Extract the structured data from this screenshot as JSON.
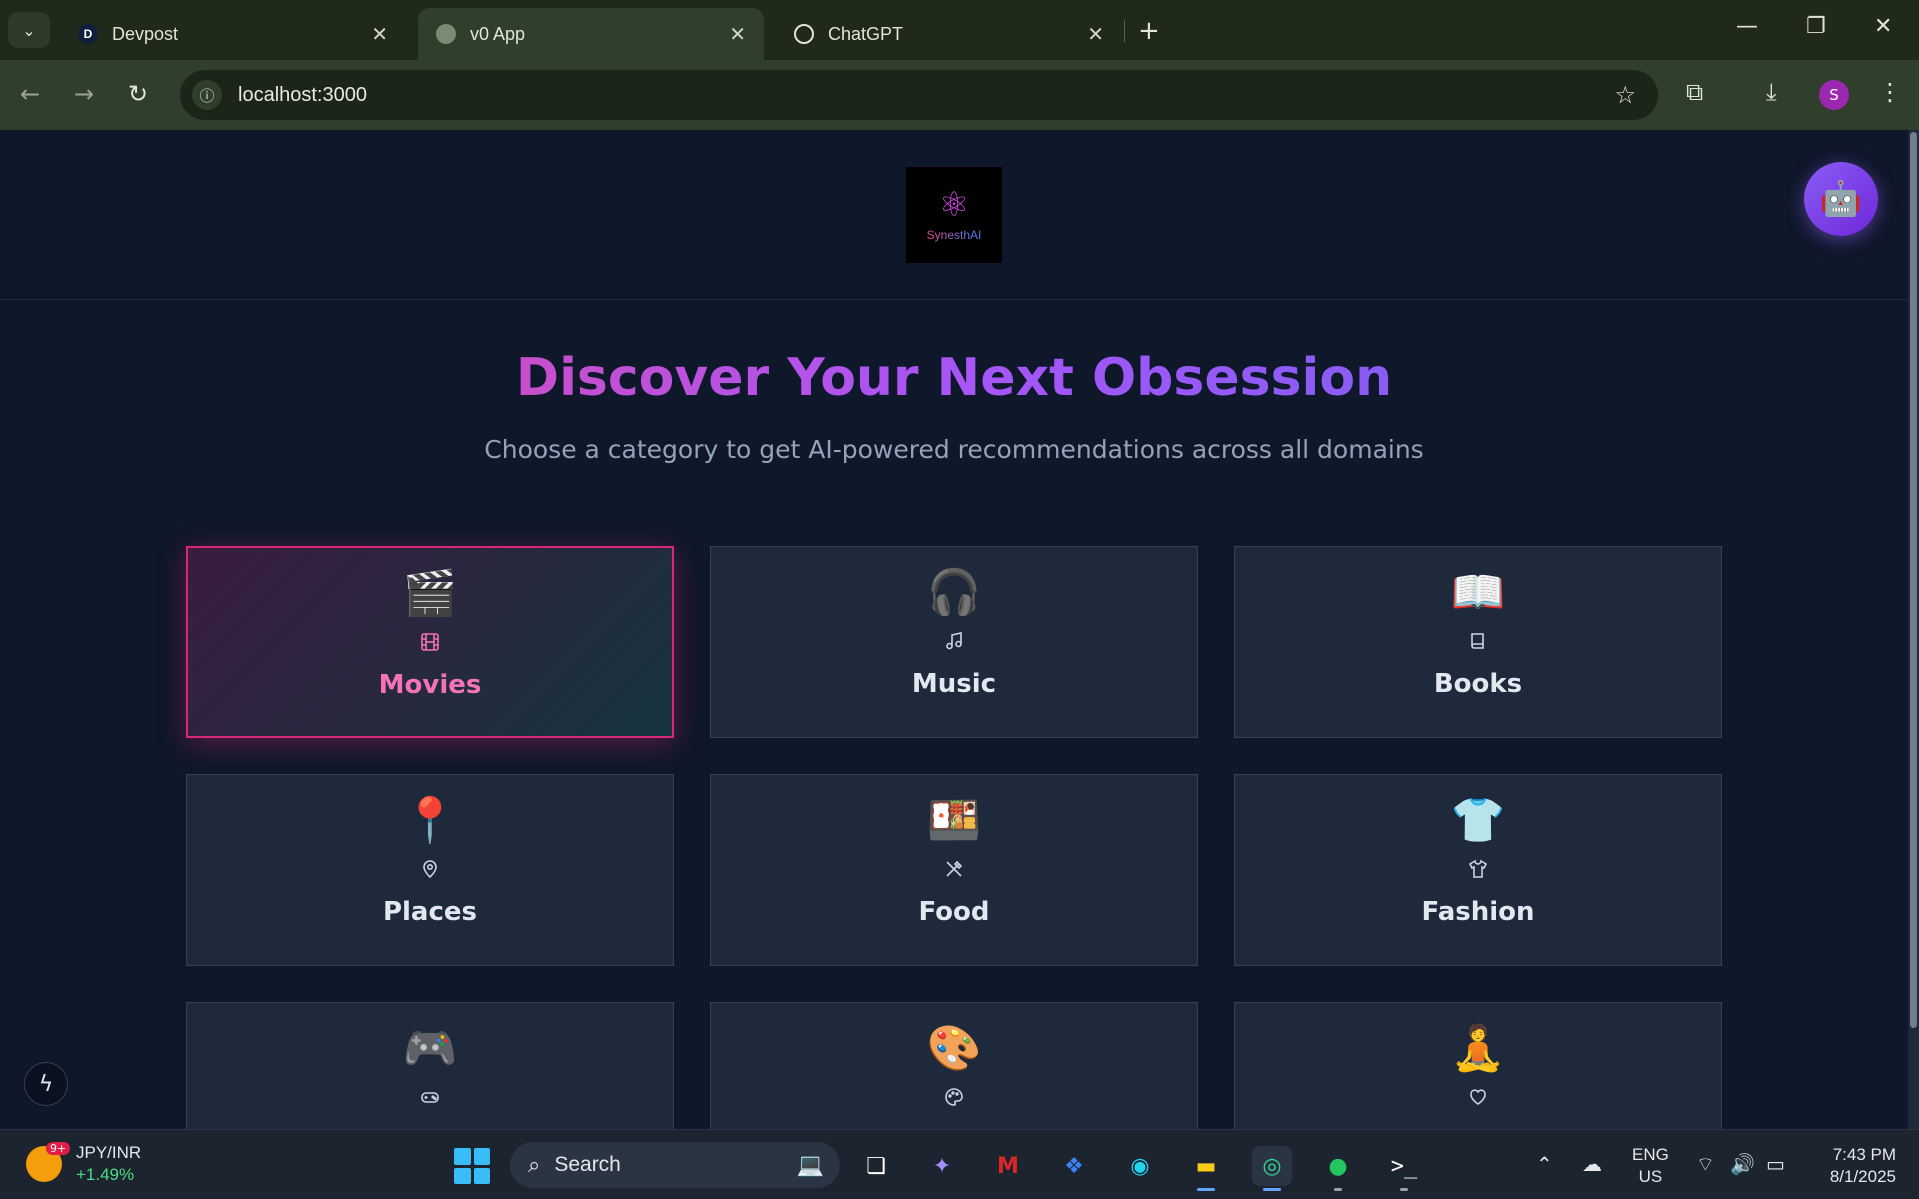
{
  "browser": {
    "tabs": [
      {
        "title": "Devpost",
        "favicon": "D"
      },
      {
        "title": "v0 App",
        "favicon": "globe-icon"
      },
      {
        "title": "ChatGPT",
        "favicon": "openai-icon"
      }
    ],
    "url": "localhost:3000",
    "profile_initial": "S"
  },
  "app": {
    "logo_text": "SynesthAI",
    "hero_title": "Discover Your Next Obsession",
    "hero_subtitle": "Choose a category to get AI-powered recommendations across all domains",
    "selected_category": "Movies",
    "categories": [
      {
        "label": "Movies",
        "emoji": "🎬",
        "icon": "film-icon"
      },
      {
        "label": "Music",
        "emoji": "🎧",
        "icon": "music-note-icon"
      },
      {
        "label": "Books",
        "emoji": "📖",
        "icon": "book-icon"
      },
      {
        "label": "Places",
        "emoji": "📍",
        "icon": "map-pin-icon"
      },
      {
        "label": "Food",
        "emoji": "🍱",
        "icon": "utensils-icon"
      },
      {
        "label": "Fashion",
        "emoji": "👕",
        "icon": "shirt-icon"
      },
      {
        "label": "",
        "emoji": "🎮",
        "icon": "gamepad-icon"
      },
      {
        "label": "",
        "emoji": "🎨",
        "icon": "palette-icon"
      },
      {
        "label": "",
        "emoji": "🧘",
        "icon": "heart-icon"
      }
    ]
  },
  "taskbar": {
    "widget_badge": "9+",
    "widget_title": "JPY/INR",
    "widget_delta": "+1.49%",
    "search_placeholder": "Search",
    "lang_line1": "ENG",
    "lang_line2": "US",
    "time": "7:43 PM",
    "date": "8/1/2025"
  },
  "colors": {
    "accent_pink": "#ec4899",
    "accent_purple": "#a855f7",
    "accent_indigo": "#6366f1",
    "page_bg": "#0f172a",
    "card_bg": "#1e293b"
  }
}
